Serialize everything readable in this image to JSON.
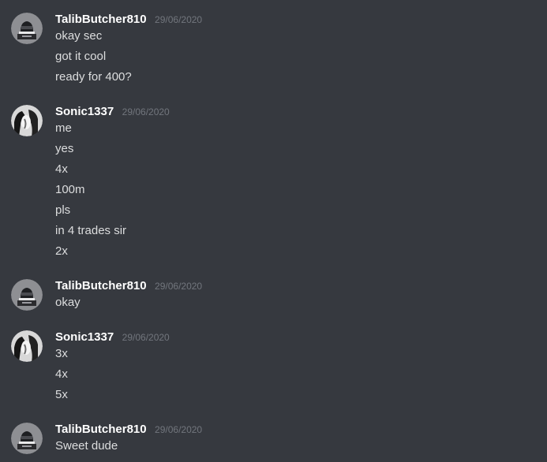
{
  "colors": {
    "background": "#36393f",
    "username": "#ffffff",
    "message_text": "#dcddde",
    "timestamp": "#72767d"
  },
  "messages": [
    {
      "author": "TalibButcher810",
      "avatar": "helmet-avatar",
      "timestamp": "29/06/2020",
      "lines": [
        "okay sec",
        "got it cool",
        "ready for 400?"
      ]
    },
    {
      "author": "Sonic1337",
      "avatar": "photo-avatar",
      "timestamp": "29/06/2020",
      "lines": [
        "me",
        "yes",
        "4x",
        "100m",
        "pls",
        "in 4 trades sir",
        "2x"
      ]
    },
    {
      "author": "TalibButcher810",
      "avatar": "helmet-avatar",
      "timestamp": "29/06/2020",
      "lines": [
        "okay"
      ]
    },
    {
      "author": "Sonic1337",
      "avatar": "photo-avatar",
      "timestamp": "29/06/2020",
      "lines": [
        "3x",
        "4x",
        "5x"
      ]
    },
    {
      "author": "TalibButcher810",
      "avatar": "helmet-avatar",
      "timestamp": "29/06/2020",
      "lines": [
        "Sweet dude"
      ]
    }
  ]
}
